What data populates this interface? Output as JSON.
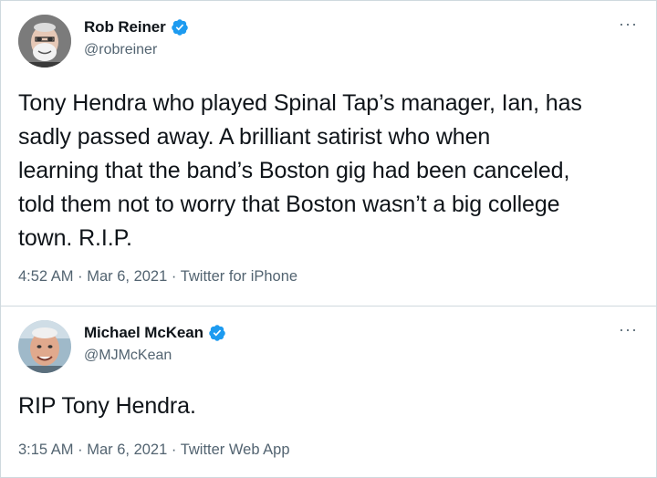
{
  "tweets": [
    {
      "display_name": "Rob Reiner",
      "handle": "@robreiner",
      "verified_icon": "verified-badge-icon",
      "text": "Tony Hendra who played Spinal Tap’s manager, Ian, has\nsadly passed away. A brilliant satirist who  when\nlearning that the band’s Boston gig had been canceled,\ntold them not to worry that Boston wasn’t a big college\ntown. R.I.P.",
      "time": "4:52 AM",
      "separator": "·",
      "date": "Mar 6, 2021",
      "source": "Twitter for iPhone",
      "more_icon": "more-options-icon"
    },
    {
      "display_name": "Michael McKean",
      "handle": "@MJMcKean",
      "verified_icon": "verified-badge-icon",
      "text": "RIP Tony Hendra.",
      "time": "3:15 AM",
      "separator": "·",
      "date": "Mar 6, 2021",
      "source": "Twitter Web App",
      "more_icon": "more-options-icon"
    }
  ],
  "colors": {
    "text": "#0f1419",
    "muted": "#536471",
    "border": "#cfd9de",
    "verified": "#1d9bf0"
  },
  "more_label": "···"
}
